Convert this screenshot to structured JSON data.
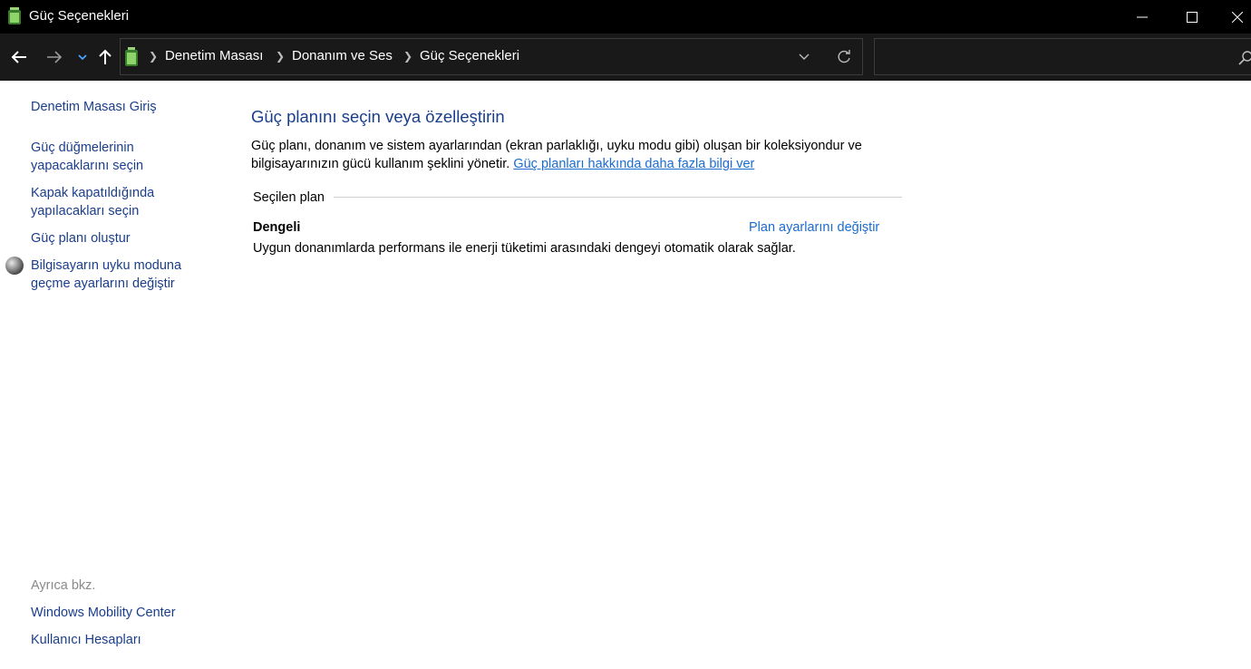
{
  "window": {
    "title": "Güç Seçenekleri",
    "icon": "battery-icon"
  },
  "nav": {
    "breadcrumb": [
      "Denetim Masası",
      "Donanım ve Ses",
      "Güç Seçenekleri"
    ],
    "search_placeholder": ""
  },
  "sidebar": {
    "home": "Denetim Masası Giriş",
    "items": [
      {
        "line1": "Güç düğmelerinin",
        "line2": "yapacaklarını seçin"
      },
      {
        "line1": "Kapak kapatıldığında",
        "line2": "yapılacakları seçin"
      },
      {
        "line1": "Güç planı oluştur",
        "line2": ""
      },
      {
        "line1": "Bilgisayarın uyku moduna",
        "line2": "geçme ayarlarını değiştir"
      }
    ],
    "see_also_label": "Ayrıca bkz.",
    "see_also": [
      "Windows Mobility Center",
      "Kullanıcı Hesapları"
    ]
  },
  "main": {
    "title": "Güç planını seçin veya özelleştirin",
    "desc_line1": "Güç planı, donanım ve sistem ayarlarından (ekran parlaklığı, uyku modu gibi) oluşan bir koleksiyondur ve",
    "desc_line2": "bilgisayarınızın gücü kullanım şeklini yönetir.",
    "desc_link": "Güç planları hakkında daha fazla bilgi ver",
    "section_label": "Seçilen plan",
    "plan": {
      "name": "Dengeli",
      "change_label": "Plan ayarlarını değiştir",
      "description": "Uygun donanımlarda performans ile enerji tüketimi arasındaki dengeyi otomatik olarak sağlar."
    }
  },
  "colors": {
    "title_bar": "#000000",
    "nav_bar": "#191919",
    "link": "#1a3e8c",
    "inline_link": "#1a6ccf"
  }
}
